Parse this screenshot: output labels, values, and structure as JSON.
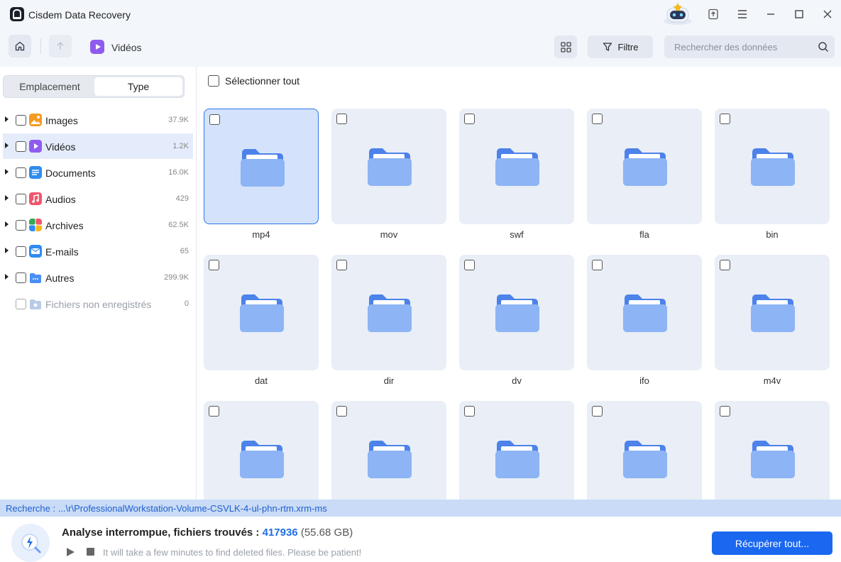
{
  "app": {
    "title": "Cisdem Data Recovery"
  },
  "titlebar": {
    "icons": [
      "robot-assistant-icon",
      "upload-icon",
      "menu-icon",
      "minimize-icon",
      "maximize-icon",
      "close-icon"
    ]
  },
  "toolbar": {
    "breadcrumb": "Vidéos",
    "filter_label": "Filtre",
    "search_placeholder": "Rechercher des données"
  },
  "sidebar": {
    "tabs": [
      {
        "label": "Emplacement"
      },
      {
        "label": "Type"
      }
    ],
    "active_tab": "Type",
    "items": [
      {
        "label": "Images",
        "count": "37.9K",
        "icon": "images-icon",
        "color": "#f59a23"
      },
      {
        "label": "Vidéos",
        "count": "1.2K",
        "icon": "videos-icon",
        "color": "#8f5bef"
      },
      {
        "label": "Documents",
        "count": "16.0K",
        "icon": "documents-icon",
        "color": "#2f8cf0"
      },
      {
        "label": "Audios",
        "count": "429",
        "icon": "audios-icon",
        "color": "#f0566b"
      },
      {
        "label": "Archives",
        "count": "62.5K",
        "icon": "archives-icon",
        "color": "#35a852"
      },
      {
        "label": "E-mails",
        "count": "65",
        "icon": "emails-icon",
        "color": "#2f8cf0"
      },
      {
        "label": "Autres",
        "count": "299.9K",
        "icon": "others-icon",
        "color": "#4a8ef5"
      },
      {
        "label": "Fichiers non enregistrés",
        "count": "0",
        "icon": "unsaved-files-icon",
        "color": "#b9cbe8"
      }
    ]
  },
  "main": {
    "select_all_label": "Sélectionner tout",
    "folders": [
      {
        "label": "mp4",
        "selected": true
      },
      {
        "label": "mov"
      },
      {
        "label": "swf"
      },
      {
        "label": "fla"
      },
      {
        "label": "bin"
      },
      {
        "label": "dat"
      },
      {
        "label": "dir"
      },
      {
        "label": "dv"
      },
      {
        "label": "ifo"
      },
      {
        "label": "m4v"
      },
      {
        "label": ""
      },
      {
        "label": ""
      },
      {
        "label": ""
      },
      {
        "label": ""
      },
      {
        "label": ""
      }
    ]
  },
  "status": {
    "path": "Recherche : ...\\r\\ProfessionalWorkstation-Volume-CSVLK-4-ul-phn-rtm.xrm-ms",
    "message_prefix": "Analyse interrompue, fichiers trouvés : ",
    "files_found": "417936",
    "size": " (55.68 GB)",
    "hint": "It will take a few minutes to find deleted files. Please be patient!",
    "recover_label": "Récupérer tout..."
  },
  "colors": {
    "accent": "#1a67f0",
    "folder": "#8db4f5",
    "folder_tab": "#4c82ea"
  }
}
